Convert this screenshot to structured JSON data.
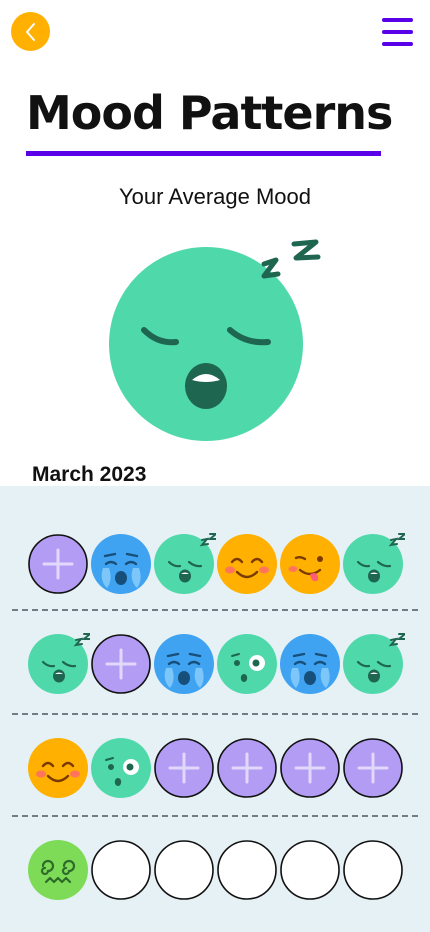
{
  "header": {
    "back_icon": "chevron-left-icon",
    "menu_icon": "hamburger-menu-icon",
    "accent": "#5A00E8",
    "back_color": "#FFB000"
  },
  "page": {
    "title": "Mood Patterns",
    "average_label": "Your Average Mood",
    "average_mood": "sleepy"
  },
  "calendar": {
    "month": "March 2023",
    "weeks": [
      [
        "add",
        "crying",
        "sleepy",
        "happy",
        "silly",
        "sleepy"
      ],
      [
        "sleepy",
        "add",
        "crying",
        "surprised",
        "crying",
        "sleepy"
      ],
      [
        "happy",
        "surprised",
        "add",
        "add",
        "add",
        "add"
      ],
      [
        "dizzy",
        "empty",
        "empty",
        "empty",
        "empty",
        "empty"
      ]
    ]
  },
  "colors": {
    "sleepy": "#4FD9AA",
    "crying": "#3FA3F1",
    "happy": "#FFB000",
    "silly": "#FFB000",
    "surprised": "#4FD9AA",
    "dizzy": "#7EDB58",
    "add": "#B39CF3",
    "calendar_bg": "#E6F1F5"
  }
}
